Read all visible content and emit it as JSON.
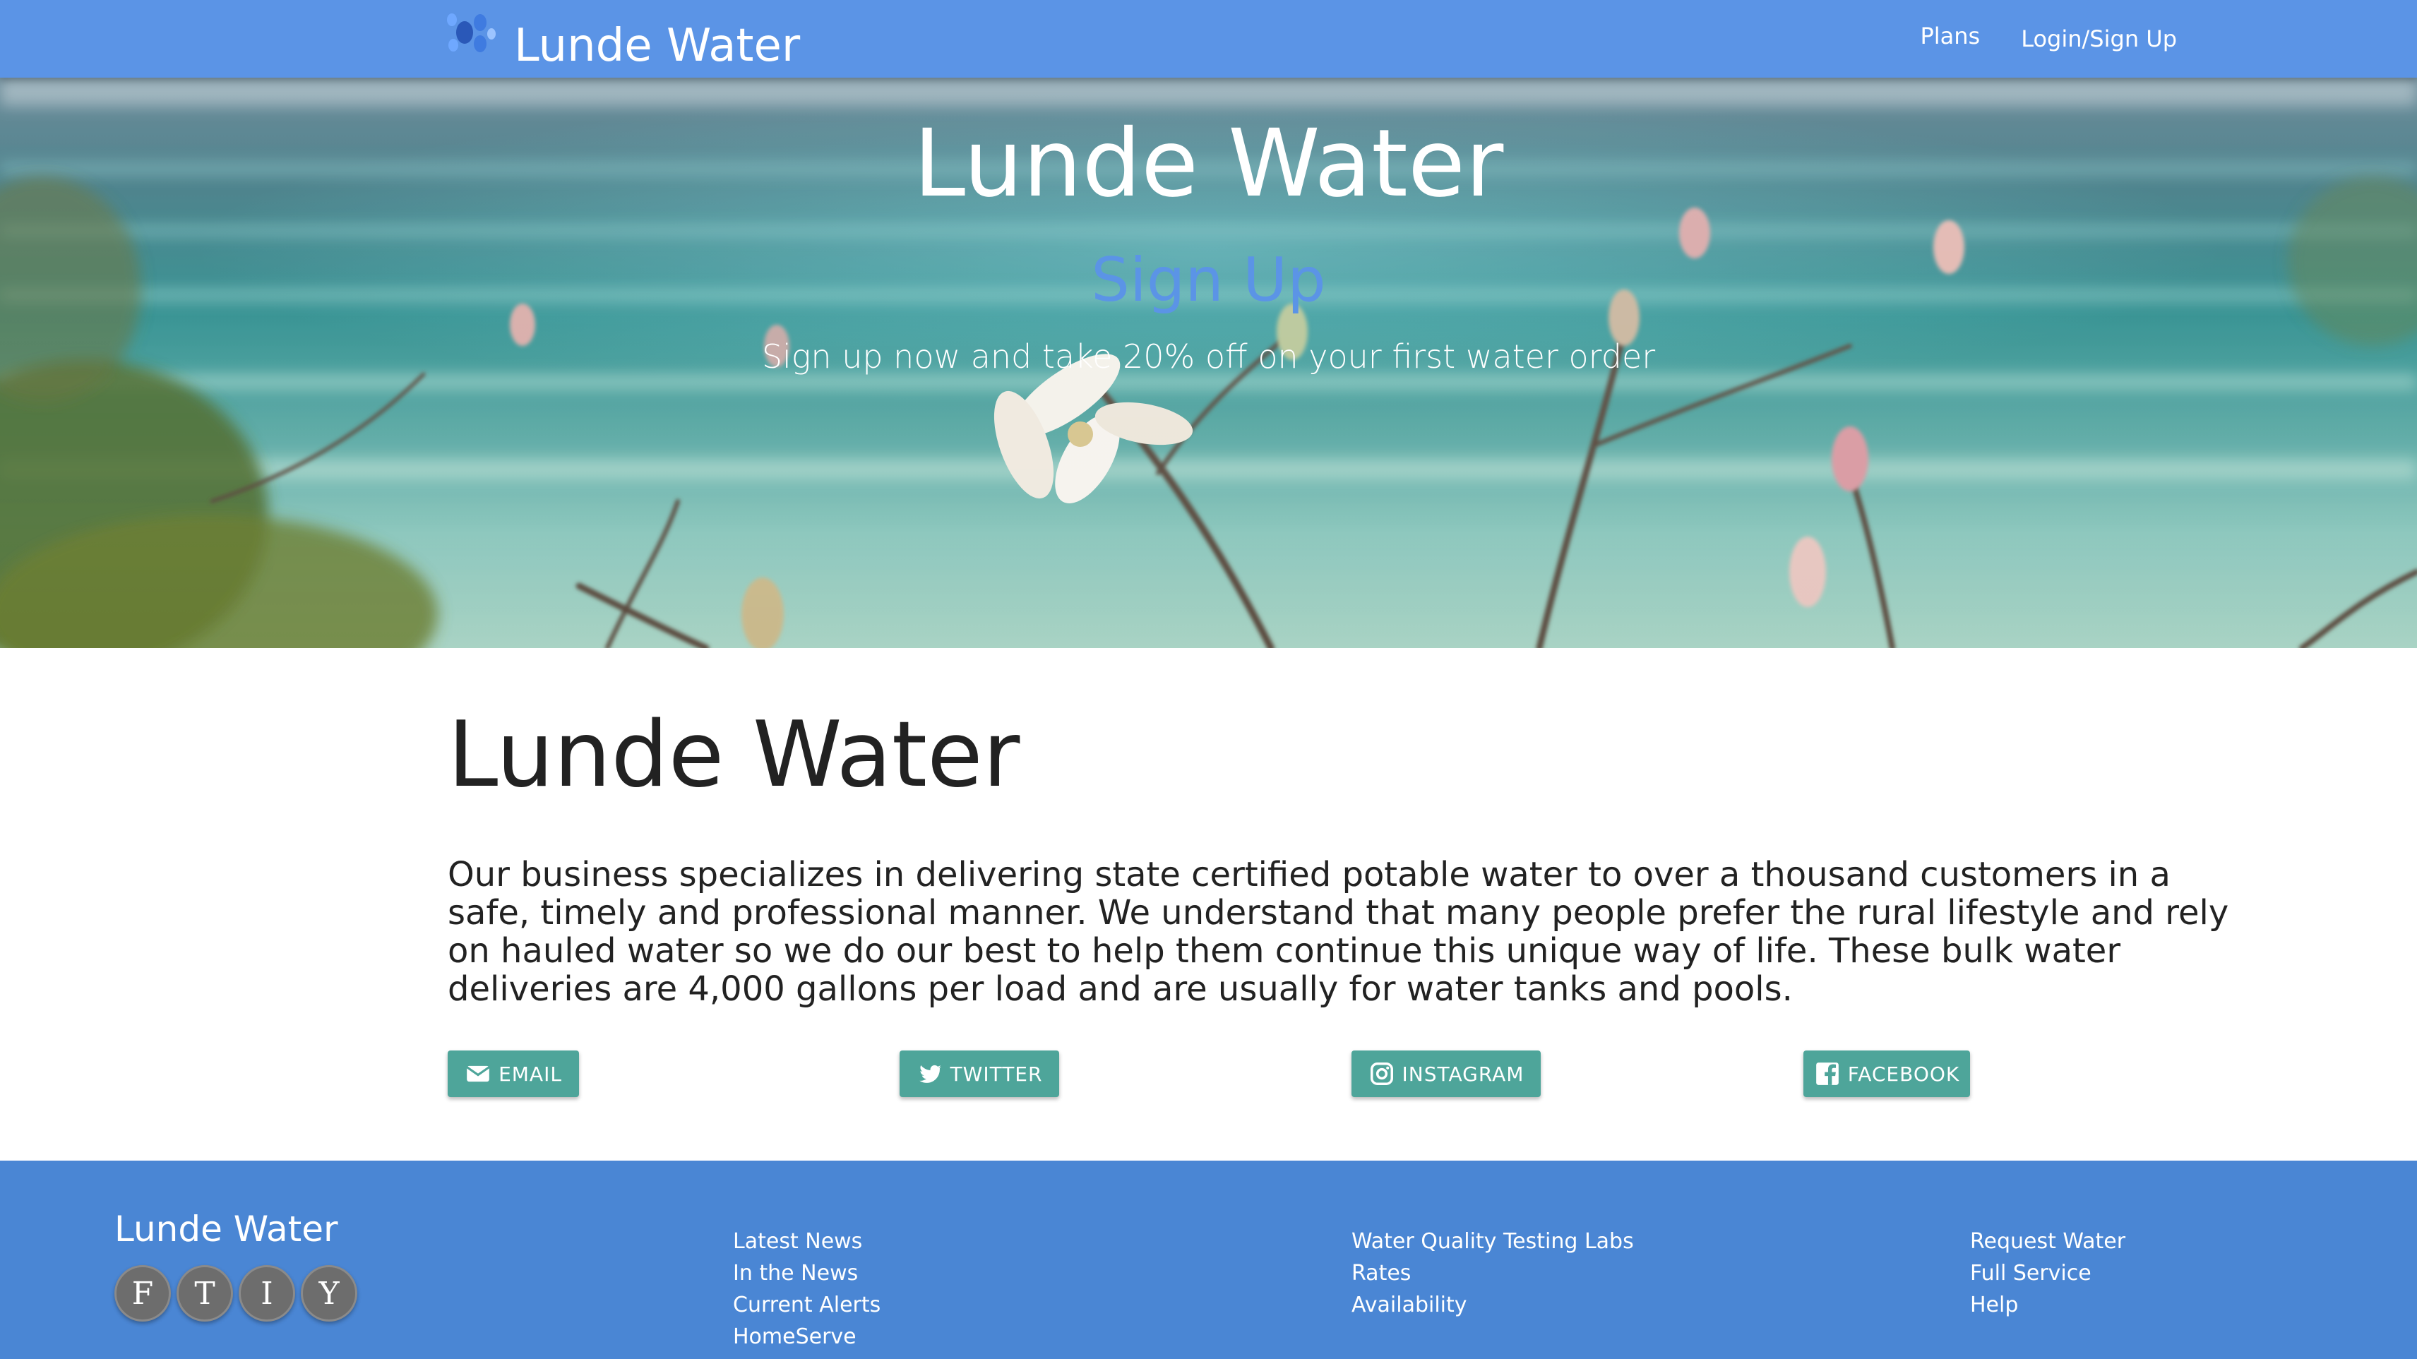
{
  "navbar": {
    "brand": "Lunde Water",
    "logo_icon": "water-drops-logo",
    "links": [
      "Plans",
      "Login/Sign Up"
    ],
    "color": "#5b94e6"
  },
  "hero": {
    "title": "Lunde Water",
    "subtitle": "Sign Up",
    "text": "Sign up now and take 20% off on your first water order",
    "subtitle_color": "#5b94e6"
  },
  "about": {
    "heading": "Lunde Water",
    "body": "Our business specializes in delivering state certified potable water to over a thousand customers in a safe, timely and professional manner. We understand that many people prefer the rural lifestyle and rely on hauled water so we do our best to help them continue this unique way of life. These bulk water deliveries are 4,000 gallons per load and are usually for water tanks and pools."
  },
  "social": {
    "buttons": [
      {
        "label": "EMAIL",
        "icon": "envelope-icon"
      },
      {
        "label": "TWITTER",
        "icon": "twitter-bird-icon"
      },
      {
        "label": "INSTAGRAM",
        "icon": "instagram-icon"
      },
      {
        "label": "FACEBOOK",
        "icon": "facebook-icon"
      }
    ],
    "color": "#4ea59a"
  },
  "footer": {
    "brand": "Lunde Water",
    "circles": [
      "F",
      "T",
      "I",
      "Y"
    ],
    "col1": [
      "Latest News",
      "In the News",
      "Current Alerts",
      "HomeServe"
    ],
    "col2": [
      "Water Quality Testing Labs",
      "Rates",
      "Availability"
    ],
    "col3": [
      "Request Water",
      "Full Service",
      "Help"
    ],
    "color": "#4a86d4"
  }
}
